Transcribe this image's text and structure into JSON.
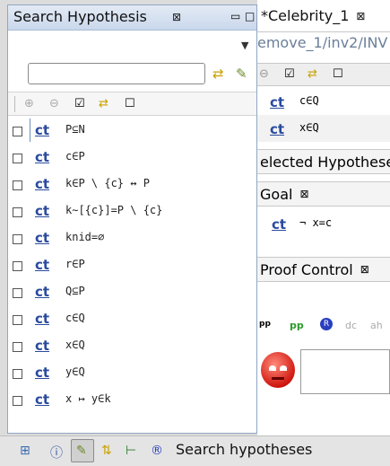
{
  "view": {
    "title": "Search Hypothesis",
    "close_icon": "close-icon",
    "menu_icon": "view-menu-icon",
    "search_value": "",
    "toolbar_icons": [
      "add-icon",
      "remove-icon",
      "select-all-icon",
      "inverse-selection-icon",
      "select-none-icon"
    ]
  },
  "hypotheses": [
    {
      "ct": "ct",
      "pred": "P⊆N"
    },
    {
      "ct": "ct",
      "pred": "c∈P"
    },
    {
      "ct": "ct",
      "pred": "k∈P \\ {c} ↔ P"
    },
    {
      "ct": "ct",
      "pred": "k∼[{c}]=P \\ {c}"
    },
    {
      "ct": "ct",
      "pred": "knid=∅"
    },
    {
      "ct": "ct",
      "pred": "r∈P"
    },
    {
      "ct": "ct",
      "pred": "Q⊆P"
    },
    {
      "ct": "ct",
      "pred": "c∈Q"
    },
    {
      "ct": "ct",
      "pred": "x∈Q"
    },
    {
      "ct": "ct",
      "pred": "y∈Q"
    },
    {
      "ct": "ct",
      "pred": "x ↦ y∈k"
    }
  ],
  "editor": {
    "tab_title": "*Celebrity_1",
    "path": "emove_1/inv2/INV",
    "rows": [
      {
        "ct": "ct",
        "pred": "c∈Q"
      },
      {
        "ct": "ct",
        "pred": "x∈Q"
      }
    ],
    "selected_header": "elected Hypotheses",
    "goal_title": "Goal",
    "goal": {
      "ct": "ct",
      "pred": "¬ x=c"
    },
    "proof_control_title": "Proof Control",
    "controls": [
      "pp",
      "pp",
      "R",
      "dc",
      "ah"
    ]
  },
  "bottom": {
    "label": "Search hypotheses",
    "icons": [
      "new-hypothesis-icon",
      "info-icon",
      "search-hyp-icon",
      "cache-icon",
      "proof-tree-icon",
      "rodin-icon"
    ]
  },
  "colors": {
    "link": "#2a4b9e",
    "accent_red": "#d0201a"
  }
}
